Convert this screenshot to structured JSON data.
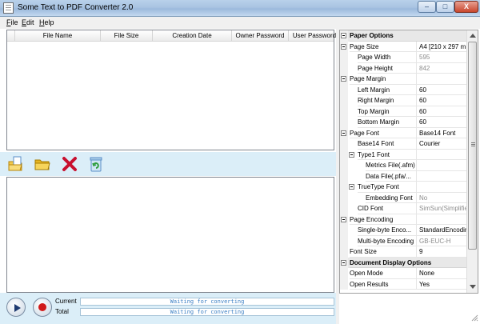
{
  "window": {
    "title": "Some Text to PDF Converter 2.0"
  },
  "window_buttons": {
    "minimize": "–",
    "maximize": "□",
    "close": "X"
  },
  "menu": [
    {
      "label": "File",
      "mnemonic": "F",
      "rest": "ile"
    },
    {
      "label": "Edit",
      "mnemonic": "E",
      "rest": "dit"
    },
    {
      "label": "Help",
      "mnemonic": "H",
      "rest": "elp"
    }
  ],
  "file_table": {
    "columns": [
      "File Name",
      "File Size",
      "Creation Date",
      "Owner Password",
      "User Password"
    ]
  },
  "toolbar": {
    "icons": [
      "add-file-icon",
      "add-folder-icon",
      "delete-icon",
      "clear-list-icon"
    ]
  },
  "progress": {
    "current_label": "Current",
    "total_label": "Total",
    "current_text": "Waiting for converting",
    "total_text": "Waiting for converting"
  },
  "properties": [
    {
      "type": "category",
      "name": "Paper Options"
    },
    {
      "type": "prop",
      "name": "Page Size",
      "value": "A4 [210 x 297 m",
      "indent": 0,
      "toggle": true
    },
    {
      "type": "prop",
      "name": "Page Width",
      "value": "595",
      "indent": 1,
      "disabled": true
    },
    {
      "type": "prop",
      "name": "Page Height",
      "value": "842",
      "indent": 1,
      "disabled": true
    },
    {
      "type": "prop",
      "name": "Page Margin",
      "value": "",
      "indent": 0,
      "toggle": true
    },
    {
      "type": "prop",
      "name": "Left Margin",
      "value": "60",
      "indent": 1
    },
    {
      "type": "prop",
      "name": "Right Margin",
      "value": "60",
      "indent": 1
    },
    {
      "type": "prop",
      "name": "Top Margin",
      "value": "60",
      "indent": 1
    },
    {
      "type": "prop",
      "name": "Bottom Margin",
      "value": "60",
      "indent": 1
    },
    {
      "type": "prop",
      "name": "Page Font",
      "value": "Base14 Font",
      "indent": 0,
      "toggle": true
    },
    {
      "type": "prop",
      "name": "Base14 Font",
      "value": "Courier",
      "indent": 1
    },
    {
      "type": "prop",
      "name": "Type1 Font",
      "value": "",
      "indent": 1,
      "toggle": true
    },
    {
      "type": "prop",
      "name": "Metrics File(.afm)",
      "value": "",
      "indent": 2
    },
    {
      "type": "prop",
      "name": "Data File(.pfa/...",
      "value": "",
      "indent": 2
    },
    {
      "type": "prop",
      "name": "TrueType Font",
      "value": "",
      "indent": 1,
      "toggle": true
    },
    {
      "type": "prop",
      "name": "Embedding Font",
      "value": "No",
      "indent": 2,
      "disabled": true
    },
    {
      "type": "prop",
      "name": "CID Font",
      "value": "SimSun(Simplifie",
      "indent": 1,
      "disabled": true
    },
    {
      "type": "prop",
      "name": "Page Encoding",
      "value": "",
      "indent": 0,
      "toggle": true
    },
    {
      "type": "prop",
      "name": "Single-byte Enco...",
      "value": "StandardEncodin",
      "indent": 1
    },
    {
      "type": "prop",
      "name": "Multi-byte Encoding",
      "value": "GB-EUC-H",
      "indent": 1,
      "disabled": true
    },
    {
      "type": "prop",
      "name": "Font Size",
      "value": "9",
      "indent": 0
    },
    {
      "type": "category",
      "name": "Document Display Options"
    },
    {
      "type": "prop",
      "name": "Open Mode",
      "value": "None",
      "indent": 0
    },
    {
      "type": "prop",
      "name": "Open Results",
      "value": "Yes",
      "indent": 0
    }
  ]
}
